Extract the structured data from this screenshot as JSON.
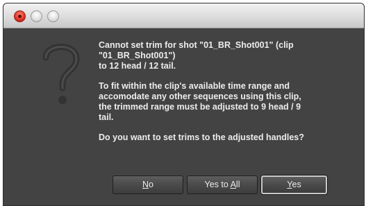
{
  "dialog": {
    "icon": "question-mark-icon",
    "title_bar": {
      "close": "close-icon",
      "minimize": "minimize-icon",
      "zoom": "zoom-icon"
    },
    "message_line1": "Cannot set trim for shot \"01_BR_Shot001\" (clip\n\"01_BR_Shot001\")\nto 12 head / 12 tail.",
    "message_line2": "To fit within the clip's available time range and\naccomodate any other sequences using this clip,\nthe trimmed range must be adjusted to 9 head / 9\ntail.",
    "question": "Do you want to set trims to the adjusted handles?"
  },
  "buttons": {
    "no": {
      "prefix": "",
      "mnemonic": "N",
      "suffix": "o"
    },
    "yes_to_all": {
      "prefix": "Yes to ",
      "mnemonic": "A",
      "suffix": "ll"
    },
    "yes": {
      "prefix": "",
      "mnemonic": "Y",
      "suffix": "es"
    }
  },
  "colors": {
    "background": "#434343",
    "text": "#ececec",
    "close_button": "#e0362a"
  }
}
